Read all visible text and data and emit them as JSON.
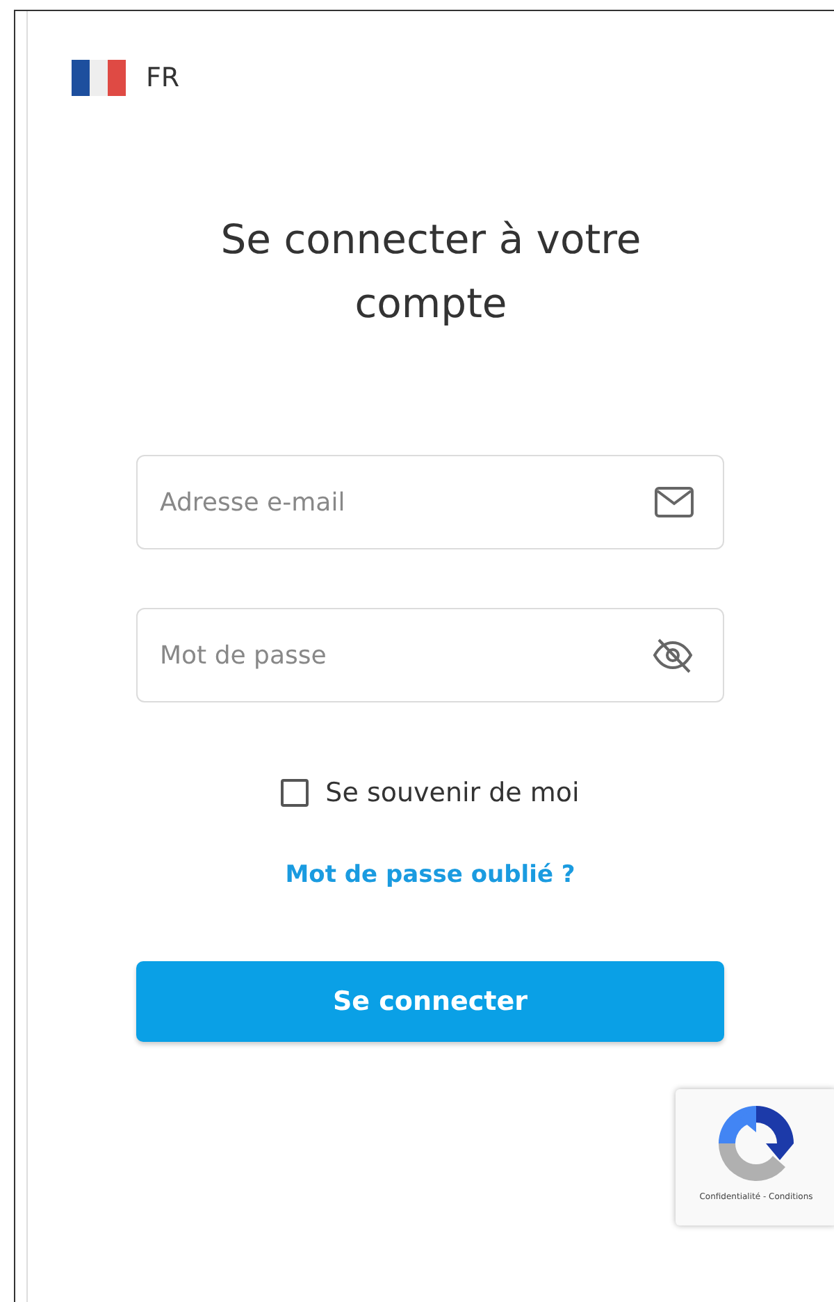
{
  "language": {
    "code": "FR"
  },
  "title": "Se connecter à votre compte",
  "fields": [
    {
      "kind": "email",
      "placeholder": "Adresse e-mail"
    },
    {
      "kind": "password",
      "placeholder": "Mot de passe"
    }
  ],
  "remember": {
    "label": "Se souvenir de moi",
    "checked": false
  },
  "forgot_link": "Mot de passe oublié ?",
  "submit": "Se connecter",
  "recaptcha": {
    "footer": "Confidentialité - Conditions"
  }
}
